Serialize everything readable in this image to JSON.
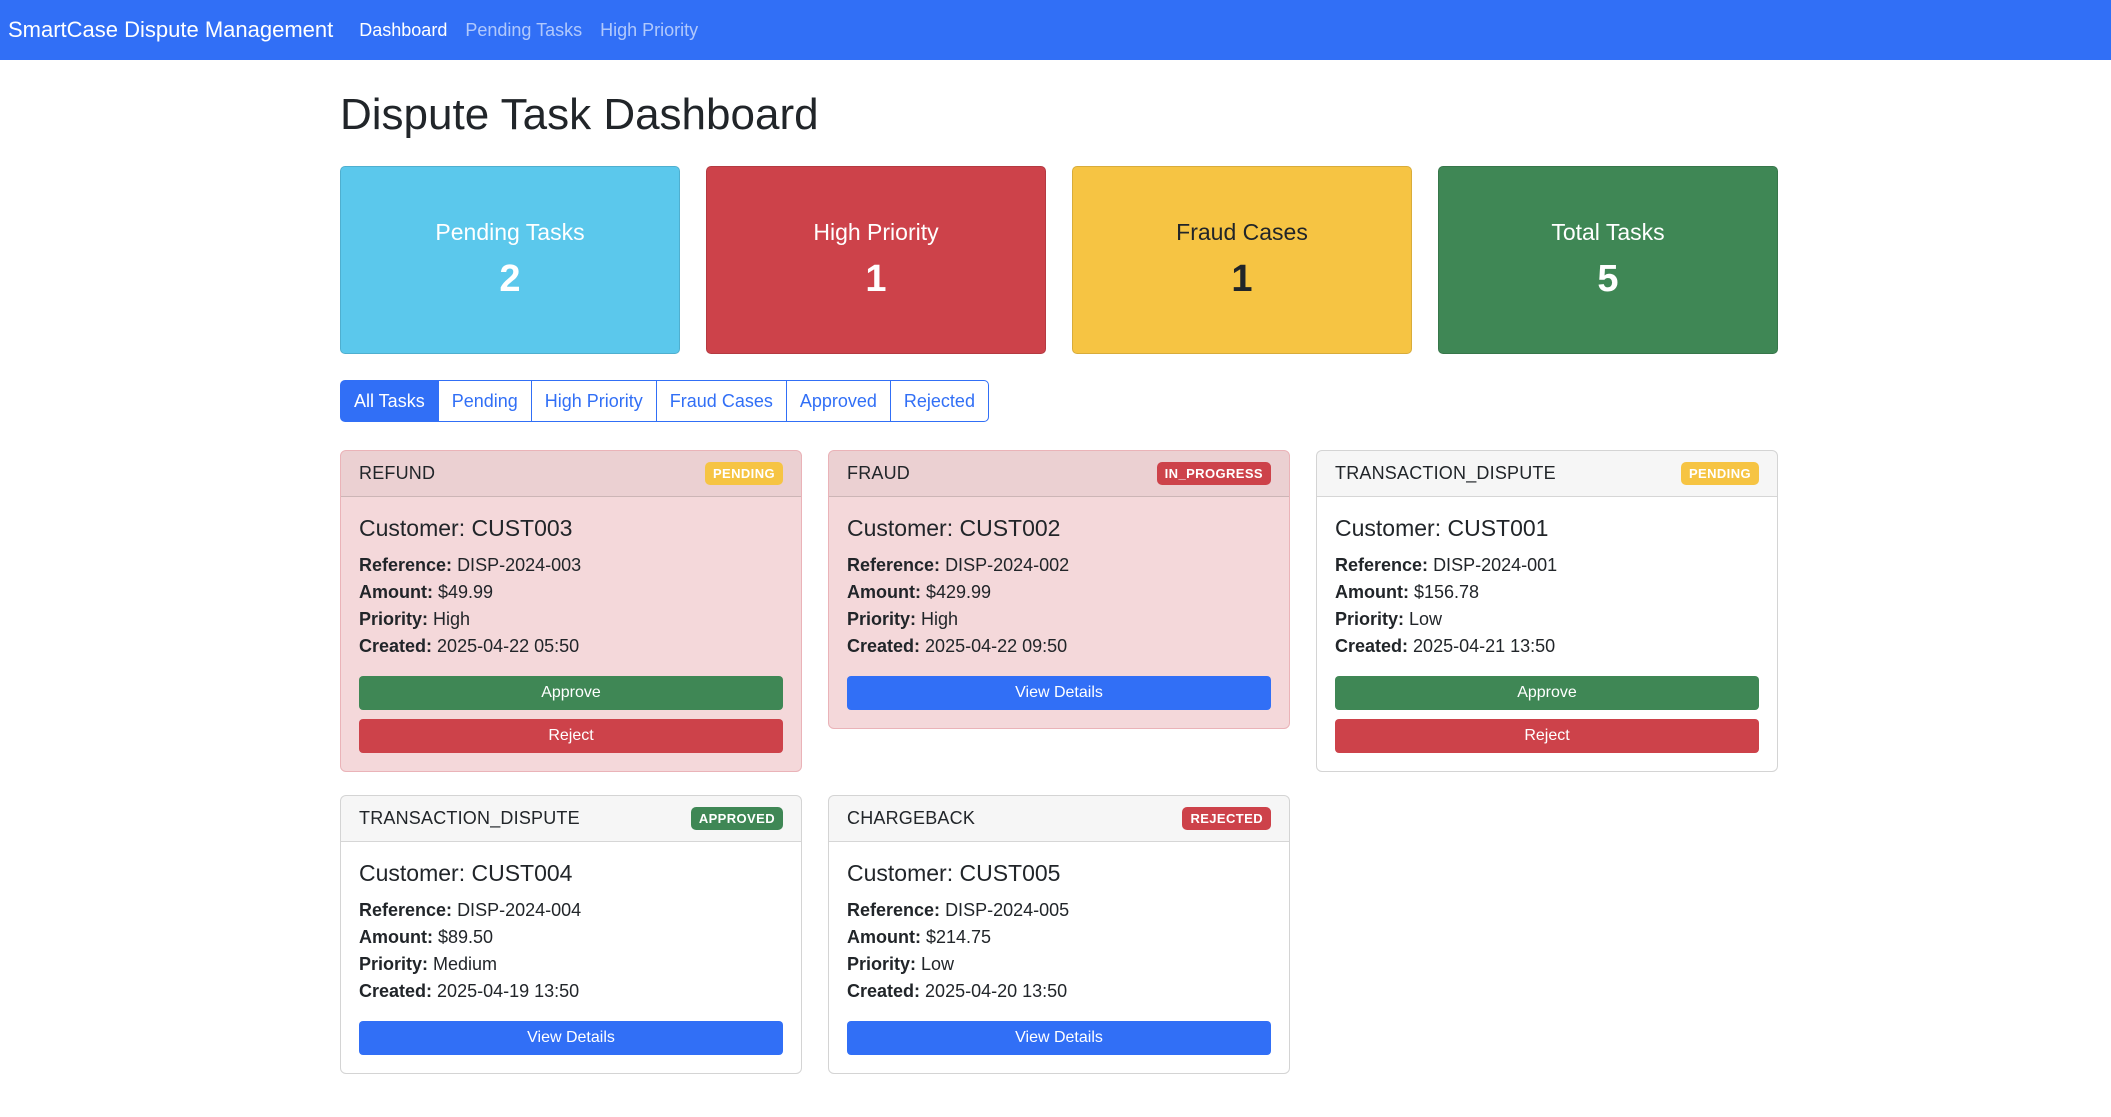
{
  "navbar": {
    "brand": "SmartCase Dispute Management",
    "links": [
      {
        "label": "Dashboard",
        "active": true
      },
      {
        "label": "Pending Tasks",
        "active": false
      },
      {
        "label": "High Priority",
        "active": false
      }
    ]
  },
  "page_title": "Dispute Task Dashboard",
  "stats": [
    {
      "label": "Pending Tasks",
      "value": "2",
      "bg": "#5bc8ec",
      "fg": "#ffffff"
    },
    {
      "label": "High Priority",
      "value": "1",
      "bg": "#cd424a",
      "fg": "#ffffff"
    },
    {
      "label": "Fraud Cases",
      "value": "1",
      "bg": "#f6c443",
      "fg": "#212529"
    },
    {
      "label": "Total Tasks",
      "value": "5",
      "bg": "#3f8755",
      "fg": "#ffffff"
    }
  ],
  "filters": [
    {
      "label": "All Tasks",
      "active": true
    },
    {
      "label": "Pending",
      "active": false
    },
    {
      "label": "High Priority",
      "active": false
    },
    {
      "label": "Fraud Cases",
      "active": false
    },
    {
      "label": "Approved",
      "active": false
    },
    {
      "label": "Rejected",
      "active": false
    }
  ],
  "labels": {
    "customer_prefix": "Customer: ",
    "reference": "Reference:",
    "amount": "Amount:",
    "priority": "Priority:",
    "created": "Created:"
  },
  "colors": {
    "primary": "#316ff6",
    "success": "#3f8755",
    "danger": "#cd424a",
    "warning": "#f6c443",
    "info": "#5bc8ec"
  },
  "tasks": [
    {
      "type": "REFUND",
      "status": "PENDING",
      "status_bg": "#f6c443",
      "status_fg": "#ffffff",
      "customer": "CUST003",
      "reference": "DISP-2024-003",
      "amount": "$49.99",
      "priority": "High",
      "created": "2025-04-22 05:50",
      "highlight": true,
      "actions": [
        {
          "label": "Approve",
          "color": "#3f8755"
        },
        {
          "label": "Reject",
          "color": "#cd424a"
        }
      ]
    },
    {
      "type": "FRAUD",
      "status": "IN_PROGRESS",
      "status_bg": "#cd424a",
      "status_fg": "#ffffff",
      "customer": "CUST002",
      "reference": "DISP-2024-002",
      "amount": "$429.99",
      "priority": "High",
      "created": "2025-04-22 09:50",
      "highlight": true,
      "actions": [
        {
          "label": "View Details",
          "color": "#316ff6"
        }
      ]
    },
    {
      "type": "TRANSACTION_DISPUTE",
      "status": "PENDING",
      "status_bg": "#f6c443",
      "status_fg": "#ffffff",
      "customer": "CUST001",
      "reference": "DISP-2024-001",
      "amount": "$156.78",
      "priority": "Low",
      "created": "2025-04-21 13:50",
      "highlight": false,
      "actions": [
        {
          "label": "Approve",
          "color": "#3f8755"
        },
        {
          "label": "Reject",
          "color": "#cd424a"
        }
      ]
    },
    {
      "type": "TRANSACTION_DISPUTE",
      "status": "APPROVED",
      "status_bg": "#3f8755",
      "status_fg": "#ffffff",
      "customer": "CUST004",
      "reference": "DISP-2024-004",
      "amount": "$89.50",
      "priority": "Medium",
      "created": "2025-04-19 13:50",
      "highlight": false,
      "actions": [
        {
          "label": "View Details",
          "color": "#316ff6"
        }
      ]
    },
    {
      "type": "CHARGEBACK",
      "status": "REJECTED",
      "status_bg": "#cd424a",
      "status_fg": "#ffffff",
      "customer": "CUST005",
      "reference": "DISP-2024-005",
      "amount": "$214.75",
      "priority": "Low",
      "created": "2025-04-20 13:50",
      "highlight": false,
      "actions": [
        {
          "label": "View Details",
          "color": "#316ff6"
        }
      ]
    }
  ]
}
